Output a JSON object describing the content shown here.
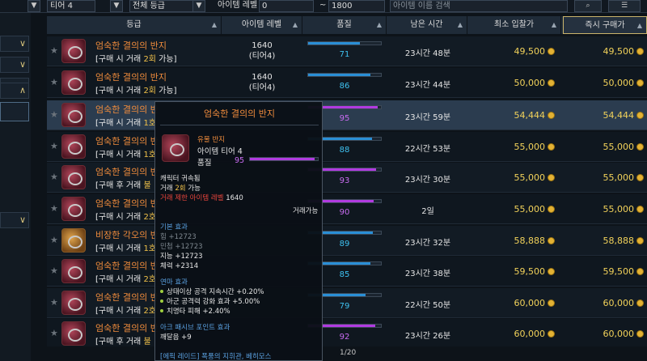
{
  "topbar": {
    "tier_select": "티어 4",
    "grade_select": "전체 등급",
    "level_label": "아이템 레벨",
    "level_min": "0",
    "level_sep": "~",
    "level_max": "1800",
    "search_placeholder": "아이템 이름 검색"
  },
  "columns": {
    "grade": "등급",
    "item_level": "아이템 레벨",
    "quality": "품질",
    "time_left": "남은 시간",
    "min_bid": "최소 입찰가",
    "buy_now": "즉시 구매가"
  },
  "rows": [
    {
      "name": "엄숙한 결의의 반지",
      "trade_prefix": "[구매 시 거래 ",
      "trade_count": "2회",
      "trade_suffix": " 가능]",
      "level": "1640",
      "tier": "(티어4)",
      "quality": "71",
      "time": "23시간 48분",
      "bid": "49,500",
      "buy": "49,500"
    },
    {
      "name": "엄숙한 결의의 반지",
      "trade_prefix": "[구매 시 거래 ",
      "trade_count": "2회",
      "trade_suffix": " 가능]",
      "level": "1640",
      "tier": "(티어4)",
      "quality": "86",
      "time": "23시간 44분",
      "bid": "50,000",
      "buy": "50,000"
    },
    {
      "name": "엄숙한 결의의 반",
      "trade_prefix": "[구매 시 거래 ",
      "trade_count": "1호",
      "trade_suffix": "",
      "level": "",
      "tier": "",
      "quality": "95",
      "time": "23시간 59분",
      "bid": "54,444",
      "buy": "54,444"
    },
    {
      "name": "엄숙한 결의의 반",
      "trade_prefix": "[구매 시 거래 ",
      "trade_count": "1호",
      "trade_suffix": "",
      "level": "",
      "tier": "",
      "quality": "88",
      "time": "22시간 53분",
      "bid": "55,000",
      "buy": "55,000"
    },
    {
      "name": "엄숙한 결의의 반",
      "trade_prefix": "[구매 후 거래 ",
      "trade_count": "불",
      "trade_suffix": "",
      "level": "",
      "tier": "",
      "quality": "93",
      "time": "23시간 30분",
      "bid": "55,000",
      "buy": "55,000"
    },
    {
      "name": "엄숙한 결의의 반",
      "trade_prefix": "[구매 시 거래 ",
      "trade_count": "2호",
      "trade_suffix": "",
      "level": "",
      "tier": "",
      "quality": "90",
      "time": "2일",
      "bid": "55,000",
      "buy": "55,000"
    },
    {
      "name": "비장한 각오의 반",
      "trade_prefix": "[구매 시 거래 ",
      "trade_count": "1호",
      "trade_suffix": "",
      "level": "",
      "tier": "",
      "quality": "89",
      "time": "23시간 32분",
      "bid": "58,888",
      "buy": "58,888"
    },
    {
      "name": "엄숙한 결의의 반",
      "trade_prefix": "[구매 시 거래 ",
      "trade_count": "2호",
      "trade_suffix": "",
      "level": "",
      "tier": "",
      "quality": "85",
      "time": "23시간 38분",
      "bid": "59,500",
      "buy": "59,500"
    },
    {
      "name": "엄숙한 결의의 반",
      "trade_prefix": "[구매 시 거래 ",
      "trade_count": "2호",
      "trade_suffix": "",
      "level": "",
      "tier": "",
      "quality": "79",
      "time": "22시간 50분",
      "bid": "60,000",
      "buy": "60,000"
    },
    {
      "name": "엄숙한 결의의 반",
      "trade_prefix": "[구매 후 거래 ",
      "trade_count": "불",
      "trade_suffix": "",
      "level": "",
      "tier": "",
      "quality": "92",
      "time": "23시간 26분",
      "bid": "60,000",
      "buy": "60,000"
    }
  ],
  "tooltip": {
    "title": "엄숙한 결의의 반지",
    "rarity": "유물 반지",
    "tier": "아이템 티어 4",
    "quality_label": "품질",
    "quality_value": "95",
    "bound": "캐릭터 귀속됨",
    "trade_prefix": "거래 ",
    "trade_count": "2회",
    "trade_suffix": " 가능",
    "trade_limit": "거래 제한 아이템 레벨",
    "trade_limit_value": "1640",
    "tradeable": "거래가능",
    "base_title": "기본 효과",
    "base_str": "힘 +12723",
    "base_dex": "민첩 +12723",
    "base_int": "지능 +12723",
    "base_hp": "체력 +2314",
    "refine_title": "연마 효과",
    "refine_1": "상태이상 공격 지속시간 +0.20%",
    "refine_2": "아군 공격력 강화 효과 +5.00%",
    "refine_3": "치명타 피해 +2.40%",
    "ark_title": "아크 패시브 포인트 효과",
    "ark_1": "깨달음 +9",
    "raid": "[에픽 레이드] 폭풍의 지휘관, 베히모스"
  },
  "pager": "1/20",
  "colors": {
    "accent": "#c9b36b",
    "item_orange": "#f08c3c",
    "price_gold": "#f2d25a",
    "quality_blue": "#3ec1f0",
    "quality_purple": "#c86cf0"
  }
}
